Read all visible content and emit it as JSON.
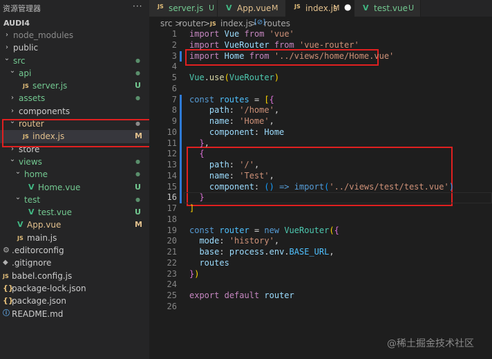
{
  "sidebar": {
    "title": "资源管理器",
    "more": "···",
    "project": "AUDI4",
    "tree": [
      {
        "label": "node_modules",
        "kind": "folder",
        "depth": 0,
        "open": false,
        "color": "dim",
        "status": ""
      },
      {
        "label": "public",
        "kind": "folder",
        "depth": 0,
        "open": false,
        "color": "normal",
        "status": ""
      },
      {
        "label": "src",
        "kind": "folder",
        "depth": 0,
        "open": true,
        "color": "untracked",
        "status": "dot"
      },
      {
        "label": "api",
        "kind": "folder",
        "depth": 1,
        "open": true,
        "color": "untracked",
        "status": "dot"
      },
      {
        "label": "server.js",
        "kind": "js",
        "depth": 2,
        "color": "untracked",
        "status": "U"
      },
      {
        "label": "assets",
        "kind": "folder",
        "depth": 1,
        "open": false,
        "color": "untracked",
        "status": "dot"
      },
      {
        "label": "components",
        "kind": "folder",
        "depth": 1,
        "open": false,
        "color": "normal",
        "status": ""
      },
      {
        "label": "router",
        "kind": "folder",
        "depth": 1,
        "open": true,
        "color": "modified",
        "status": "dot"
      },
      {
        "label": "index.js",
        "kind": "js",
        "depth": 2,
        "color": "modified",
        "status": "M",
        "selected": true
      },
      {
        "label": "store",
        "kind": "folder",
        "depth": 1,
        "open": false,
        "color": "normal",
        "status": ""
      },
      {
        "label": "views",
        "kind": "folder",
        "depth": 1,
        "open": true,
        "color": "untracked",
        "status": "dot"
      },
      {
        "label": "home",
        "kind": "folder",
        "depth": 2,
        "open": true,
        "color": "untracked",
        "status": "dot"
      },
      {
        "label": "Home.vue",
        "kind": "vue",
        "depth": 3,
        "color": "untracked",
        "status": "U"
      },
      {
        "label": "test",
        "kind": "folder",
        "depth": 2,
        "open": true,
        "color": "untracked",
        "status": "dot"
      },
      {
        "label": "test.vue",
        "kind": "vue",
        "depth": 3,
        "color": "untracked",
        "status": "U"
      },
      {
        "label": "App.vue",
        "kind": "vue",
        "depth": 1,
        "color": "modified",
        "status": "M"
      },
      {
        "label": "main.js",
        "kind": "js",
        "depth": 1,
        "color": "normal",
        "status": ""
      },
      {
        "label": ".editorconfig",
        "kind": "gear",
        "depth": 0,
        "color": "normal",
        "status": ""
      },
      {
        "label": ".gitignore",
        "kind": "dot",
        "depth": 0,
        "color": "normal",
        "status": ""
      },
      {
        "label": "babel.config.js",
        "kind": "js",
        "depth": 0,
        "color": "normal",
        "status": ""
      },
      {
        "label": "package-lock.json",
        "kind": "json",
        "depth": 0,
        "color": "normal",
        "status": ""
      },
      {
        "label": "package.json",
        "kind": "json",
        "depth": 0,
        "color": "normal",
        "status": ""
      },
      {
        "label": "README.md",
        "kind": "info",
        "depth": 0,
        "color": "normal",
        "status": ""
      }
    ]
  },
  "tabs": [
    {
      "label": "server.js",
      "kind": "js",
      "badge": "U",
      "color": "untracked",
      "active": false
    },
    {
      "label": "App.vue",
      "kind": "vue",
      "badge": "M",
      "color": "modified",
      "active": false
    },
    {
      "label": "index.js",
      "kind": "js",
      "badge": "M",
      "color": "modified",
      "active": true,
      "dirty": true
    },
    {
      "label": "test.vue",
      "kind": "vue",
      "badge": "U",
      "color": "untracked",
      "active": false
    }
  ],
  "breadcrumb": {
    "parts": [
      "src",
      ">",
      "router",
      ">",
      "index.js",
      ">",
      "routes"
    ],
    "file_icon": "JS",
    "symbol_icon": "[⊘]"
  },
  "editor": {
    "current_line": 16,
    "lines": [
      [
        [
          "import",
          "kw2"
        ],
        [
          " ",
          "txt"
        ],
        [
          "Vue",
          "var"
        ],
        [
          " ",
          "txt"
        ],
        [
          "from",
          "kw2"
        ],
        [
          " ",
          "txt"
        ],
        [
          "'vue'",
          "str"
        ]
      ],
      [
        [
          "import",
          "kw2"
        ],
        [
          " ",
          "txt"
        ],
        [
          "VueRouter",
          "var"
        ],
        [
          " ",
          "txt"
        ],
        [
          "from",
          "kw2"
        ],
        [
          " ",
          "txt"
        ],
        [
          "'vue-router'",
          "str"
        ]
      ],
      [
        [
          "import",
          "kw2"
        ],
        [
          " ",
          "txt"
        ],
        [
          "Home",
          "var"
        ],
        [
          " ",
          "txt"
        ],
        [
          "from",
          "kw2"
        ],
        [
          " ",
          "txt"
        ],
        [
          "'../views/home/Home.vue'",
          "str"
        ]
      ],
      [],
      [
        [
          "Vue",
          "cls"
        ],
        [
          ".",
          "txt"
        ],
        [
          "use",
          "fn"
        ],
        [
          "(",
          "br"
        ],
        [
          "VueRouter",
          "cls"
        ],
        [
          ")",
          "br"
        ]
      ],
      [],
      [
        [
          "const",
          "kw"
        ],
        [
          " ",
          "txt"
        ],
        [
          "routes",
          "const"
        ],
        [
          " = ",
          "txt"
        ],
        [
          "[",
          "br"
        ],
        [
          "{",
          "br2"
        ]
      ],
      [
        [
          "    path",
          "var"
        ],
        [
          ": ",
          "txt"
        ],
        [
          "'/home'",
          "str"
        ],
        [
          ",",
          "txt"
        ]
      ],
      [
        [
          "    name",
          "var"
        ],
        [
          ": ",
          "txt"
        ],
        [
          "'Home'",
          "str"
        ],
        [
          ",",
          "txt"
        ]
      ],
      [
        [
          "    component",
          "var"
        ],
        [
          ": ",
          "txt"
        ],
        [
          "Home",
          "var"
        ]
      ],
      [
        [
          "  ",
          "txt"
        ],
        [
          "}",
          "br2"
        ],
        [
          ",",
          "txt"
        ]
      ],
      [
        [
          "  ",
          "txt"
        ],
        [
          "{",
          "br2"
        ]
      ],
      [
        [
          "    path",
          "var"
        ],
        [
          ": ",
          "txt"
        ],
        [
          "'/'",
          "str"
        ],
        [
          ",",
          "txt"
        ]
      ],
      [
        [
          "    name",
          "var"
        ],
        [
          ": ",
          "txt"
        ],
        [
          "'Test'",
          "str"
        ],
        [
          ",",
          "txt"
        ]
      ],
      [
        [
          "    component",
          "var"
        ],
        [
          ": ",
          "txt"
        ],
        [
          "()",
          "br3"
        ],
        [
          " ",
          "txt"
        ],
        [
          "=>",
          "kw"
        ],
        [
          " ",
          "txt"
        ],
        [
          "import",
          "kw"
        ],
        [
          "(",
          "br3"
        ],
        [
          "'../views/test/test.vue'",
          "str"
        ],
        [
          ")",
          "br3"
        ]
      ],
      [
        [
          "  ",
          "txt"
        ],
        [
          "}",
          "br2"
        ]
      ],
      [
        [
          "]",
          "br"
        ]
      ],
      [],
      [
        [
          "const",
          "kw"
        ],
        [
          " ",
          "txt"
        ],
        [
          "router",
          "const"
        ],
        [
          " = ",
          "txt"
        ],
        [
          "new",
          "kw"
        ],
        [
          " ",
          "txt"
        ],
        [
          "VueRouter",
          "cls"
        ],
        [
          "(",
          "br"
        ],
        [
          "{",
          "br2"
        ]
      ],
      [
        [
          "  mode",
          "var"
        ],
        [
          ": ",
          "txt"
        ],
        [
          "'history'",
          "str"
        ],
        [
          ",",
          "txt"
        ]
      ],
      [
        [
          "  base",
          "var"
        ],
        [
          ": ",
          "txt"
        ],
        [
          "process",
          "var"
        ],
        [
          ".",
          "txt"
        ],
        [
          "env",
          "var"
        ],
        [
          ".",
          "txt"
        ],
        [
          "BASE_URL",
          "const"
        ],
        [
          ",",
          "txt"
        ]
      ],
      [
        [
          "  routes",
          "var"
        ]
      ],
      [
        [
          "}",
          "br2"
        ],
        [
          ")",
          "br"
        ]
      ],
      [],
      [
        [
          "export",
          "kw2"
        ],
        [
          " ",
          "txt"
        ],
        [
          "default",
          "kw2"
        ],
        [
          " ",
          "txt"
        ],
        [
          "router",
          "var"
        ]
      ],
      []
    ]
  },
  "colors": {
    "highlight_box": "#e02020",
    "git_modified_bar": "#2f7bd6",
    "untracked": "#73c991",
    "modified": "#e2c08d"
  },
  "watermark": "@稀土掘金技术社区"
}
